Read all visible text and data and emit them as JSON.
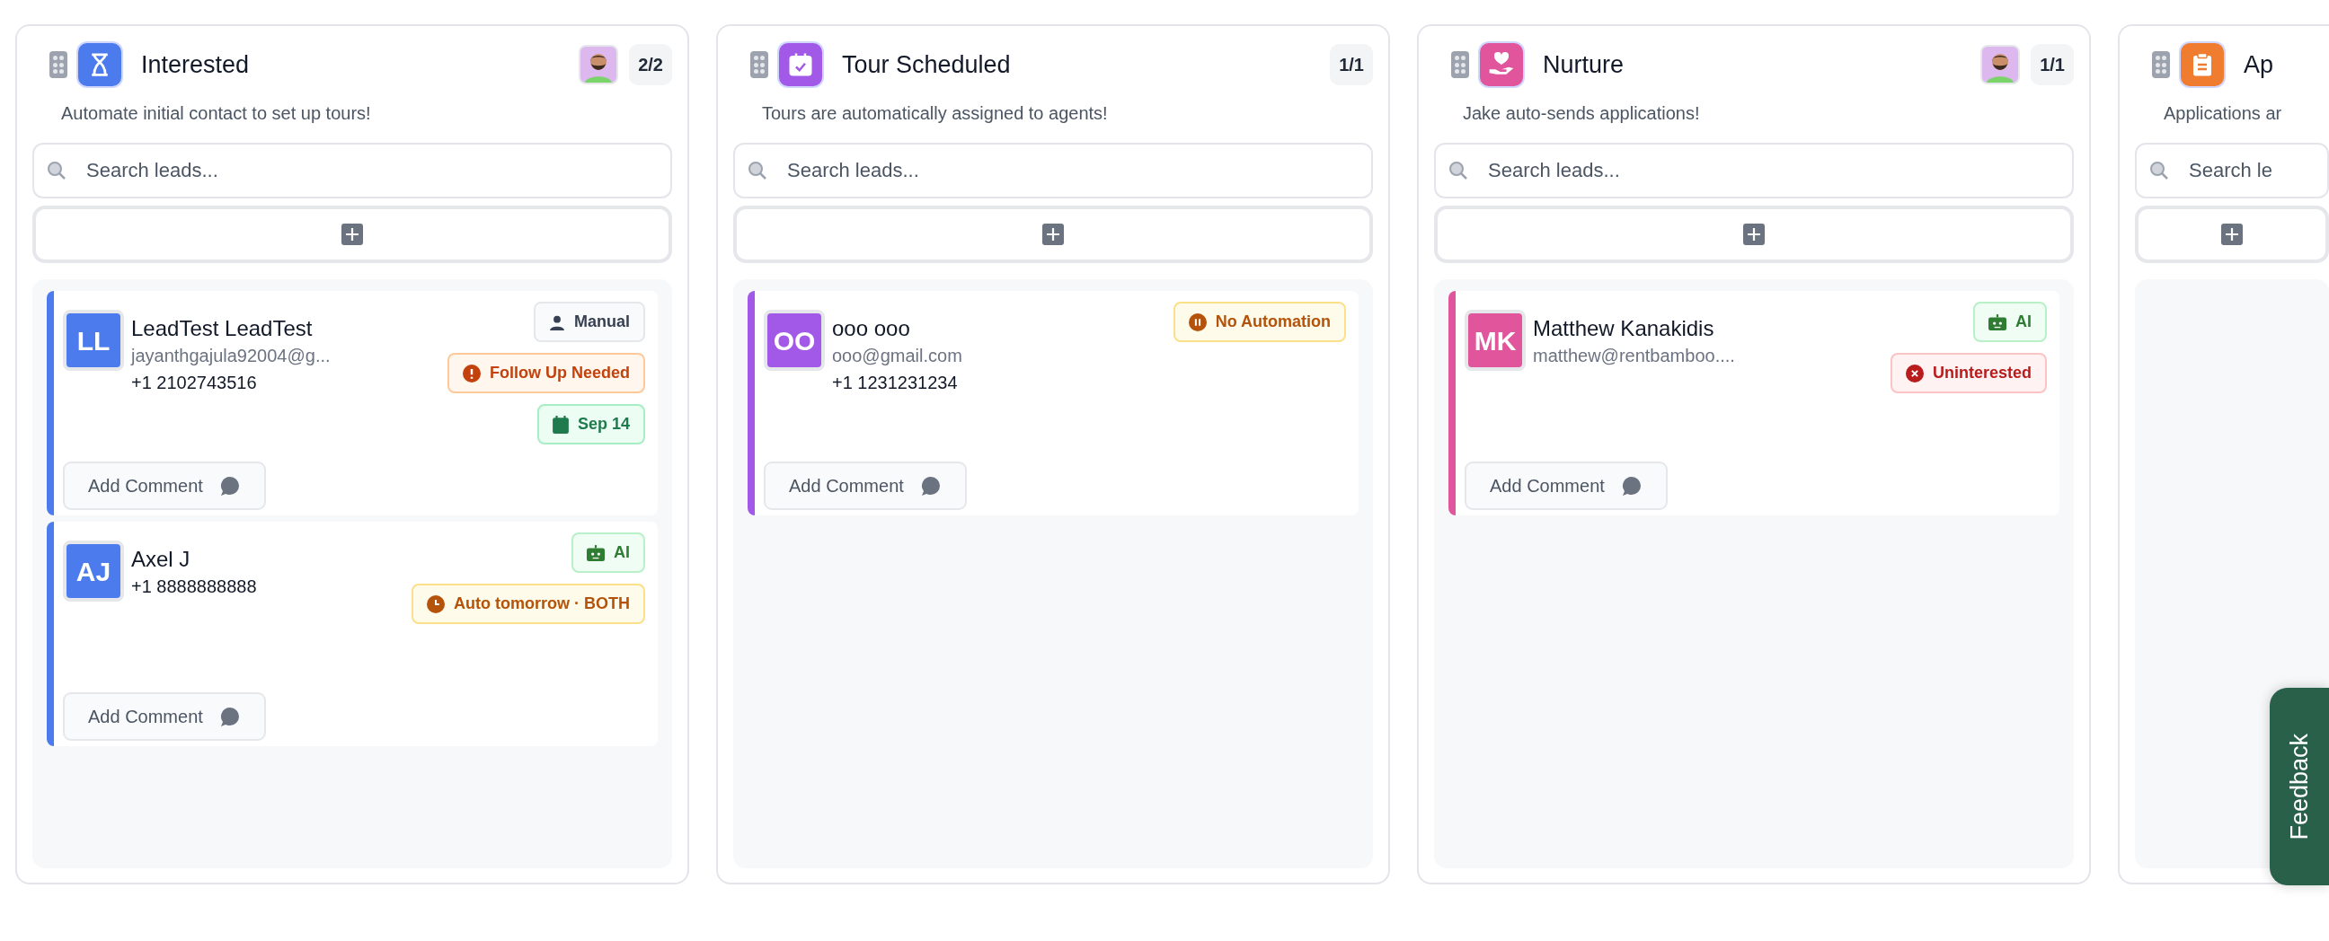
{
  "columns": [
    {
      "title": "Interested",
      "description": "Automate initial contact to set up tours!",
      "color": "#4b7bec",
      "has_agent": true,
      "count": "2/2",
      "search": {
        "placeholder": "Search leads..."
      },
      "cards": [
        {
          "initials": "LL",
          "name": "LeadTest LeadTest",
          "email": "jayanthgajula92004@g...",
          "phone": "+1 2102743516",
          "badges": [
            {
              "kind": "manual",
              "text": "Manual"
            },
            {
              "kind": "warning",
              "text": "Follow Up Needed"
            },
            {
              "kind": "date",
              "text": "Sep 14"
            }
          ],
          "comment_button": "Add Comment"
        },
        {
          "initials": "AJ",
          "name": "Axel J",
          "phone": "+1 8888888888",
          "badges": [
            {
              "kind": "ai",
              "text": "AI"
            },
            {
              "kind": "auto",
              "text": "Auto tomorrow · BOTH"
            }
          ],
          "comment_button": "Add Comment"
        }
      ]
    },
    {
      "title": "Tour Scheduled",
      "description": "Tours are automatically assigned to agents!",
      "color": "#a259e8",
      "has_agent": false,
      "count": "1/1",
      "search": {
        "placeholder": "Search leads..."
      },
      "cards": [
        {
          "initials": "OO",
          "name": "ooo ooo",
          "email": "ooo@gmail.com",
          "phone": "+1 1231231234",
          "badges": [
            {
              "kind": "paused",
              "text": "No Automation"
            }
          ],
          "comment_button": "Add Comment"
        }
      ]
    },
    {
      "title": "Nurture",
      "description": "Jake auto-sends applications!",
      "color": "#e0559b",
      "has_agent": true,
      "count": "1/1",
      "search": {
        "placeholder": "Search leads..."
      },
      "cards": [
        {
          "initials": "MK",
          "name": "Matthew Kanakidis",
          "email": "matthew@rentbamboo....",
          "badges": [
            {
              "kind": "ai",
              "text": "AI"
            },
            {
              "kind": "uninterested",
              "text": "Uninterested"
            }
          ],
          "comment_button": "Add Comment"
        }
      ]
    },
    {
      "title": "Ap",
      "description": "Applications ar",
      "color": "#f07c30",
      "has_agent": false,
      "search": {
        "placeholder": "Search le"
      }
    }
  ],
  "feedback_tab": "Feedback"
}
